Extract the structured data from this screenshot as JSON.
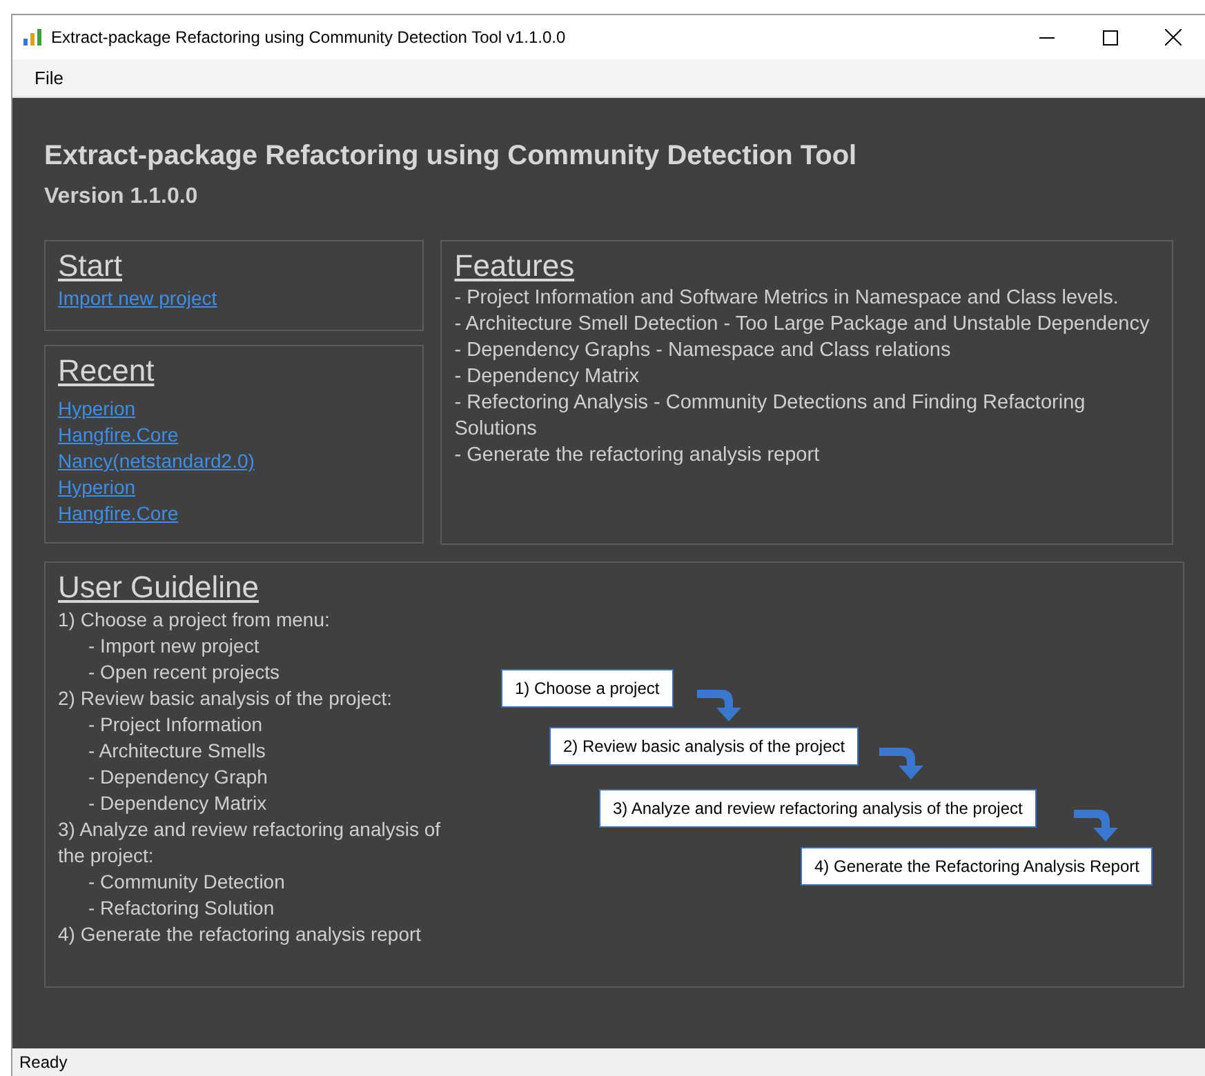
{
  "window": {
    "title": "Extract-package Refactoring using Community Detection Tool v1.1.0.0"
  },
  "menu": [
    "File"
  ],
  "header": {
    "title": "Extract-package Refactoring using Community Detection Tool",
    "version": "Version 1.1.0.0"
  },
  "start": {
    "title": "Start",
    "links": [
      "Import new project"
    ]
  },
  "recent": {
    "title": "Recent",
    "links": [
      "Hyperion",
      "Hangfire.Core",
      "Nancy(netstandard2.0)",
      "Hyperion",
      "Hangfire.Core"
    ]
  },
  "features": {
    "title": "Features",
    "items": [
      "- Project Information and Software Metrics in Namespace and Class levels.",
      "- Architecture Smell Detection - Too Large Package and Unstable Dependency",
      "- Dependency Graphs - Namespace and Class relations",
      "- Dependency Matrix",
      "- Refectoring Analysis - Community Detections and Finding Refactoring Solutions",
      "- Generate the refactoring analysis report"
    ]
  },
  "guideline": {
    "title": "User Guideline",
    "steps": [
      {
        "text": "1) Choose a project from menu:",
        "children": [
          "- Import new project",
          "- Open recent projects"
        ]
      },
      {
        "text": "2) Review basic analysis of the project:",
        "children": [
          "- Project Information",
          "- Architecture Smells",
          "- Dependency Graph",
          "- Dependency Matrix"
        ]
      },
      {
        "text": "3) Analyze and review refactoring analysis of the project:",
        "children": [
          "- Community Detection",
          "- Refactoring Solution"
        ]
      },
      {
        "text": "4) Generate the refactoring analysis report"
      }
    ],
    "flow": [
      "1) Choose a project",
      "2) Review basic analysis of the project",
      "3) Analyze and review refactoring analysis of the project",
      "4) Generate the Refactoring Analysis Report"
    ]
  },
  "status_bar": "Ready"
}
